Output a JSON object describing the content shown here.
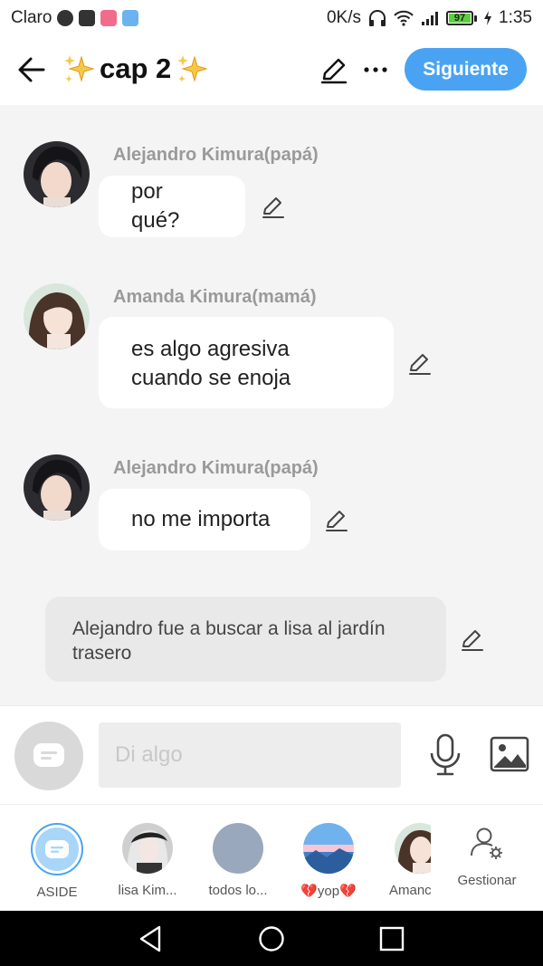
{
  "status_bar": {
    "carrier": "Claro",
    "speed": "0K/s",
    "battery_level": "97",
    "time": "1:35",
    "icons": [
      "spotify-icon",
      "youtube-icon",
      "manga-toon-icon",
      "novel-toon-icon",
      "headphones-icon",
      "wifi-icon",
      "signal-icon",
      "battery-icon",
      "charging-icon"
    ]
  },
  "header": {
    "title": "cap 2",
    "next_label": "Siguiente"
  },
  "colors": {
    "accent": "#4aa3f2",
    "bubble_bg": "#ffffff",
    "narration_bg": "#e9e9e9",
    "chat_bg": "#f4f4f4",
    "sender_name": "#9a9a9a"
  },
  "messages": [
    {
      "sender": "Alejandro Kimura(papá)",
      "text": "por qué?",
      "avatar": "alejandro-avatar"
    },
    {
      "sender": "Amanda Kimura(mamá)",
      "text_lines": [
        "es algo agresiva",
        "cuando se enoja"
      ],
      "avatar": "amanda-avatar"
    },
    {
      "sender": "Alejandro Kimura(papá)",
      "text": "no me importa",
      "avatar": "alejandro-avatar"
    }
  ],
  "narration": {
    "text_lines": [
      "Alejandro fue a buscar a lisa al jardín",
      "trasero"
    ]
  },
  "input": {
    "placeholder": "Di algo"
  },
  "tray": {
    "items": [
      {
        "label": "ASIDE"
      },
      {
        "label": "lisa Kim..."
      },
      {
        "label": "todos lo..."
      },
      {
        "label": "💔yop💔"
      },
      {
        "label": "Amanc"
      }
    ],
    "manage_label": "Gestionar"
  }
}
